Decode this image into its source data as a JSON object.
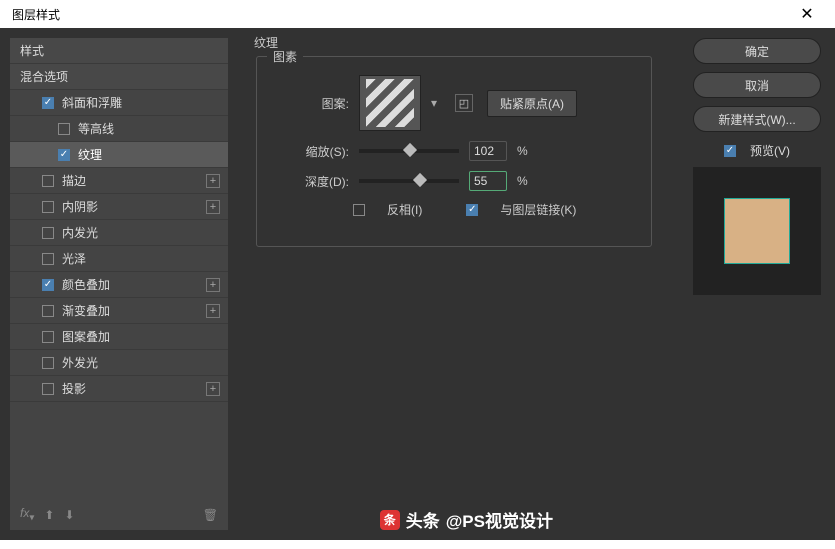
{
  "title": "图层样式",
  "sidebar": {
    "header1": "样式",
    "header2": "混合选项",
    "items": [
      {
        "label": "斜面和浮雕",
        "checked": true,
        "has_plus": false
      },
      {
        "label": "等高线",
        "checked": false,
        "sub": true
      },
      {
        "label": "纹理",
        "checked": true,
        "sub": true,
        "active": true
      },
      {
        "label": "描边",
        "checked": false,
        "has_plus": true
      },
      {
        "label": "内阴影",
        "checked": false,
        "has_plus": true
      },
      {
        "label": "内发光",
        "checked": false
      },
      {
        "label": "光泽",
        "checked": false
      },
      {
        "label": "颜色叠加",
        "checked": true,
        "has_plus": true
      },
      {
        "label": "渐变叠加",
        "checked": false,
        "has_plus": true
      },
      {
        "label": "图案叠加",
        "checked": false
      },
      {
        "label": "外发光",
        "checked": false
      },
      {
        "label": "投影",
        "checked": false,
        "has_plus": true
      }
    ],
    "fx": "fx"
  },
  "panel": {
    "group_title": "纹理",
    "fieldset_label": "图素",
    "pattern_label": "图案:",
    "snap_btn": "贴紧原点(A)",
    "scale_label": "缩放(S):",
    "scale_value": "102",
    "depth_label": "深度(D):",
    "depth_value": "55",
    "pct": "%",
    "invert_label": "反相(I)",
    "invert_checked": false,
    "link_label": "与图层链接(K)",
    "link_checked": true
  },
  "buttons": {
    "ok": "确定",
    "cancel": "取消",
    "new_style": "新建样式(W)...",
    "preview": "预览(V)"
  },
  "watermark": {
    "prefix": "头条",
    "text": "@PS视觉设计"
  }
}
